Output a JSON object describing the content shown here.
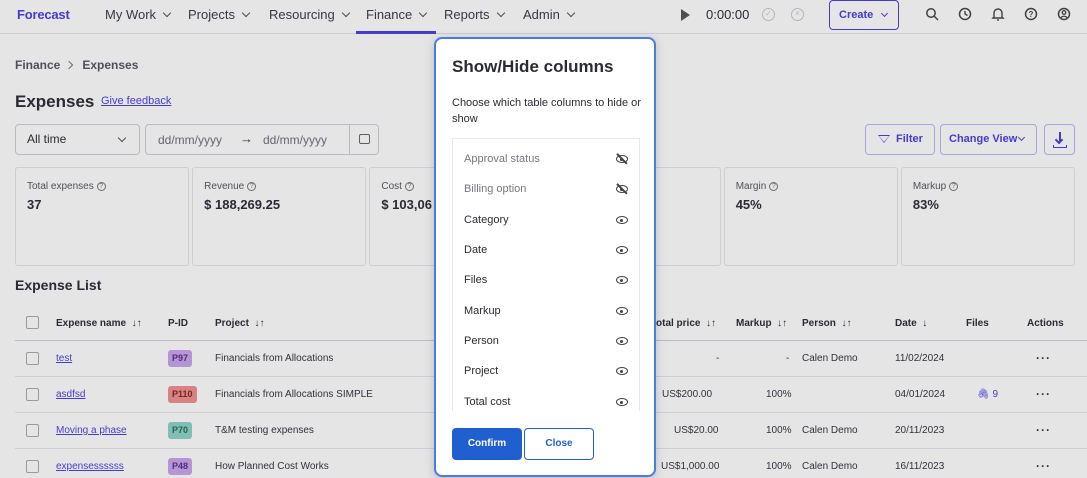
{
  "app": {
    "logo": "Forecast"
  },
  "nav": {
    "items": [
      {
        "label": "My Work"
      },
      {
        "label": "Projects"
      },
      {
        "label": "Resourcing"
      },
      {
        "label": "Finance"
      },
      {
        "label": "Reports"
      },
      {
        "label": "Admin"
      }
    ],
    "timer": "0:00:00",
    "create_label": "Create"
  },
  "breadcrumb": {
    "parent": "Finance",
    "current": "Expenses"
  },
  "page": {
    "title": "Expenses",
    "feedback_link": "Give feedback"
  },
  "filters": {
    "period_value": "All time",
    "date_from_placeholder": "dd/mm/yyyy",
    "date_to_placeholder": "dd/mm/yyyy",
    "arrow": "→",
    "filter_label": "Filter",
    "change_view_label": "Change View"
  },
  "stats": [
    {
      "label": "Total expenses",
      "value": "37"
    },
    {
      "label": "Revenue",
      "value": "$ 188,269.25"
    },
    {
      "label": "Cost",
      "value": "$ 103,06"
    },
    {
      "label": "",
      "value": ""
    },
    {
      "label": "Margin",
      "value": "45%"
    },
    {
      "label": "Markup",
      "value": "83%"
    }
  ],
  "list": {
    "title": "Expense List",
    "columns": {
      "expense_name": "Expense name",
      "pid": "P-ID",
      "project": "Project",
      "total_price": "otal price",
      "markup": "Markup",
      "person": "Person",
      "date": "Date",
      "files": "Files",
      "actions": "Actions"
    },
    "rows": [
      {
        "name": "test",
        "pid": "P97",
        "pid_color": "#c9a6ec",
        "project": "Financials from Allocations",
        "total_price": "-",
        "markup": "-",
        "person": "Calen Demo",
        "date": "11/02/2024",
        "files": ""
      },
      {
        "name": "asdfsd",
        "pid": "P110",
        "pid_color": "#ef8f8f",
        "project": "Financials from Allocations SIMPLE",
        "total_price": "US$200.00",
        "markup": "100%",
        "person": "",
        "date": "04/01/2024",
        "files": "9"
      },
      {
        "name": "Moving a phase",
        "pid": "P70",
        "pid_color": "#8ed3c7",
        "project": "T&M testing expenses",
        "total_price": "US$20.00",
        "markup": "100%",
        "person": "Calen Demo",
        "date": "20/11/2023",
        "files": ""
      },
      {
        "name": "expensessssss",
        "pid": "P48",
        "pid_color": "#c9a6ec",
        "project": "How Planned Cost Works",
        "total_price": "US$1,000.00",
        "markup": "100%",
        "person": "Calen Demo",
        "date": "16/11/2023",
        "files": ""
      }
    ],
    "actions_glyph": "···"
  },
  "modal": {
    "title": "Show/Hide columns",
    "description": "Choose which table columns to hide or show",
    "columns": [
      {
        "name": "Approval status",
        "visible": false
      },
      {
        "name": "Billing option",
        "visible": false
      },
      {
        "name": "Category",
        "visible": true
      },
      {
        "name": "Date",
        "visible": true
      },
      {
        "name": "Files",
        "visible": true
      },
      {
        "name": "Markup",
        "visible": true
      },
      {
        "name": "Person",
        "visible": true
      },
      {
        "name": "Project",
        "visible": true
      },
      {
        "name": "Total cost",
        "visible": true
      }
    ],
    "confirm_label": "Confirm",
    "close_label": "Close"
  }
}
